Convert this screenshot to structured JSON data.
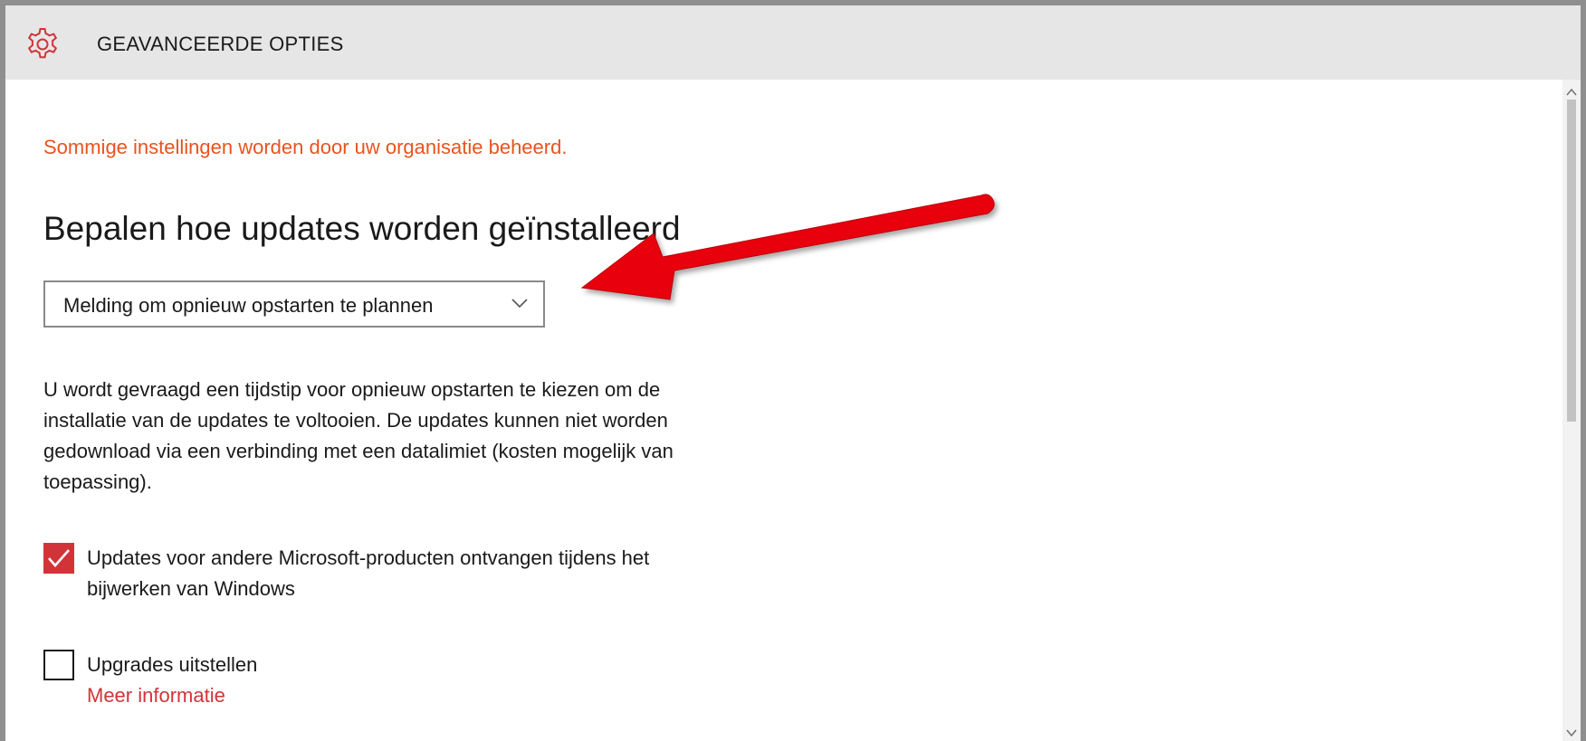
{
  "window": {
    "title": "GEAVANCEERDE OPTIES",
    "title_icon": "gear-icon"
  },
  "content": {
    "managed_notice": "Sommige instellingen worden door uw organisatie beheerd.",
    "section_heading": "Bepalen hoe updates worden geïnstalleerd",
    "install_mode_dropdown": {
      "selected": "Melding om opnieuw opstarten te plannen",
      "icon": "chevron-down-icon"
    },
    "description": "U wordt gevraagd een tijdstip voor opnieuw opstarten te kiezen om de installatie van de updates te voltooien. De updates kunnen niet worden gedownload via een verbinding met een datalimiet (kosten mogelijk van toepassing).",
    "options": [
      {
        "label": "Updates voor andere Microsoft-producten ontvangen tijdens het bijwerken van Windows",
        "checked": true
      },
      {
        "label": "Upgrades uitstellen",
        "checked": false,
        "link": "Meer informatie"
      }
    ]
  },
  "scrollbar": {
    "up_icon": "scroll-up-icon",
    "down_icon": "scroll-down-icon"
  },
  "annotation": {
    "type": "arrow",
    "color": "#e8000b",
    "points_to": "install_mode_dropdown"
  },
  "colors": {
    "accent": "#d13438",
    "warning_text": "#e8531e",
    "titlebar_bg": "#e6e6e6"
  }
}
